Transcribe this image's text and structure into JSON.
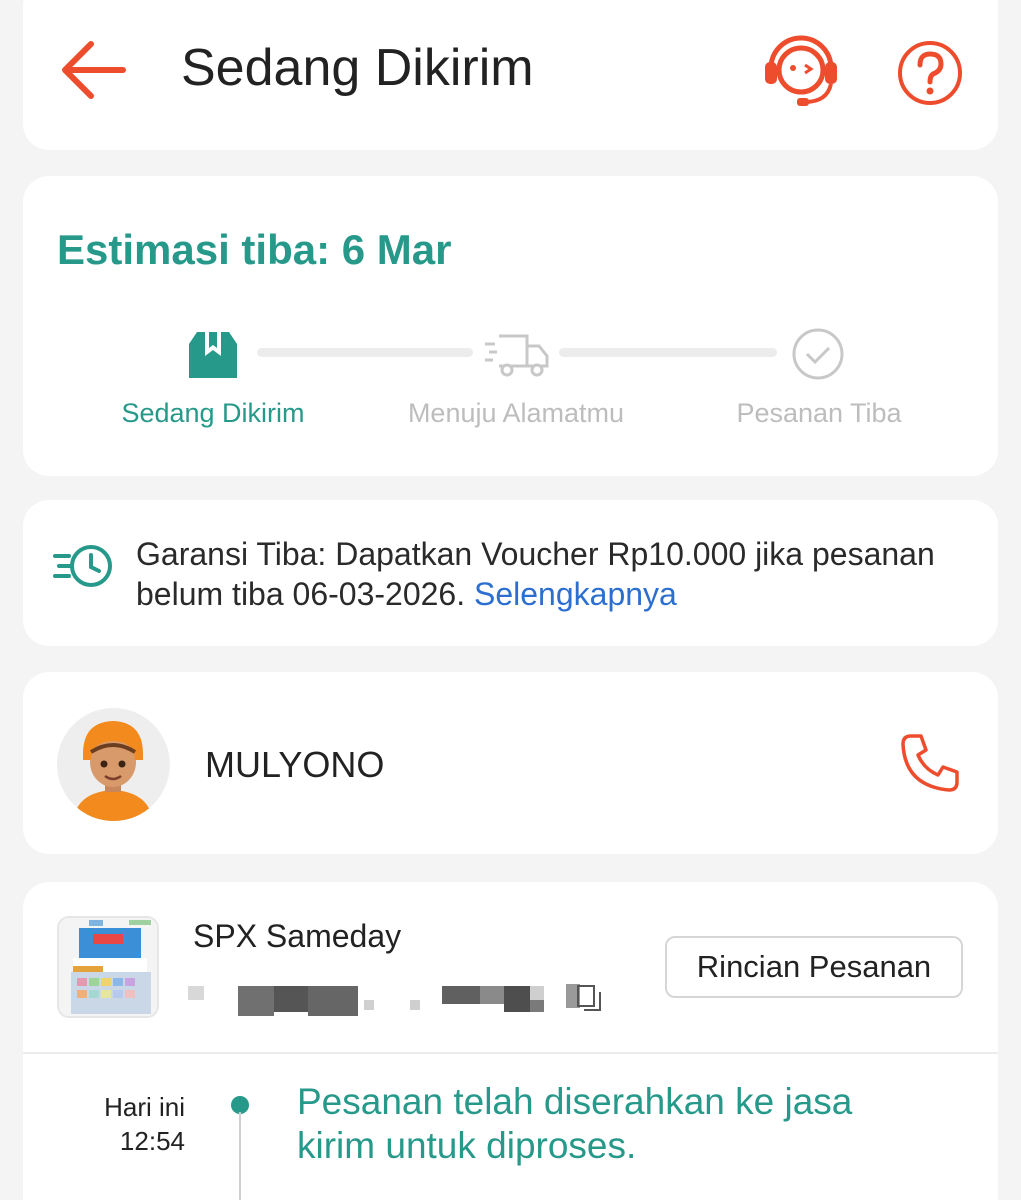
{
  "header": {
    "title": "Sedang Dikirim",
    "icons": {
      "back": "arrow-left-icon",
      "support": "customer-service-icon",
      "help": "question-icon"
    }
  },
  "estimate": {
    "title": "Estimasi tiba: 6 Mar",
    "steps": [
      {
        "label": "Sedang Dikirim",
        "icon": "package-icon",
        "active": true
      },
      {
        "label": "Menuju Alamatmu",
        "icon": "truck-icon",
        "active": false
      },
      {
        "label": "Pesanan Tiba",
        "icon": "check-circle-icon",
        "active": false
      }
    ]
  },
  "guarantee": {
    "text": "Garansi Tiba: Dapatkan Voucher Rp10.000 jika pesanan belum tiba 06-03-2026.",
    "link": "Selengkapnya",
    "icon": "fast-clock-icon"
  },
  "courier": {
    "name": "MULYONO",
    "icon": "phone-icon"
  },
  "shipment": {
    "service": "SPX Sameday",
    "details_button": "Rincian Pesanan",
    "timeline": [
      {
        "day": "Hari ini",
        "time": "12:54",
        "text": "Pesanan telah diserahkan ke jasa kirim untuk diproses."
      }
    ]
  },
  "colors": {
    "accent": "#26998a",
    "brand": "#ee4d2d",
    "link": "#2c6fd1",
    "inactive": "#c8c8c8"
  }
}
